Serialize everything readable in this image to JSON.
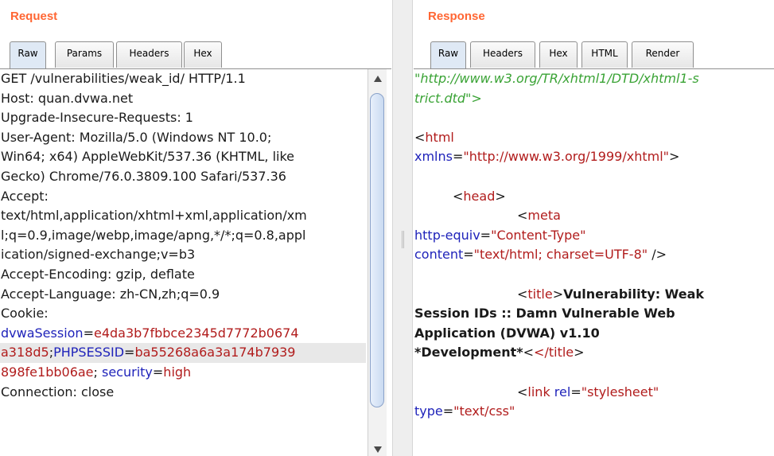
{
  "request": {
    "title": "Request",
    "tabs": [
      "Raw",
      "Params",
      "Headers",
      "Hex"
    ],
    "lines": [
      "GET /vulnerabilities/weak_id/ HTTP/1.1",
      "Host: quan.dvwa.net",
      "Upgrade-Insecure-Requests: 1",
      "User-Agent: Mozilla/5.0 (Windows NT 10.0;",
      "Win64; x64) AppleWebKit/537.36 (KHTML, like",
      "Gecko) Chrome/76.0.3809.100 Safari/537.36",
      "Accept:",
      "text/html,application/xhtml+xml,application/xm",
      "l;q=0.9,image/webp,image/apng,*/*;q=0.8,appl",
      "ication/signed-exchange;v=b3",
      "Accept-Encoding: gzip, deflate",
      "Accept-Language: zh-CN,zh;q=0.9",
      "Cookie:"
    ],
    "cookie": {
      "k1": "dvwaSession",
      "v1a": "e4da3b7fbbce2345d7772b0674",
      "v1b": "a318d5",
      "sep1": ";",
      "k2": "PHPSESSID",
      "v2a": "ba55268a6a3a174b7939",
      "v2b": "898fe1bb06ae",
      "sep2": "; ",
      "k3": "security",
      "v3": "high",
      "eq": "="
    },
    "last_line": "Connection: close"
  },
  "response": {
    "title": "Response",
    "tabs": [
      "Raw",
      "Headers",
      "Hex",
      "HTML",
      "Render"
    ],
    "dtd1": "\"http://www.w3.org/TR/xhtml1/DTD/xhtml1-s",
    "dtd2": "trict.dtd\">",
    "lt": "<",
    "gt": ">",
    "html_tag": "html",
    "xmlns_attr": "xmlns",
    "xmlns_val": "\"http://www.w3.org/1999/xhtml\"",
    "head_tag": "head",
    "meta_tag": "meta",
    "httpequiv_attr": "http-equiv",
    "httpequiv_val": "\"Content-Type\"",
    "content_attr": "content",
    "content_val": "\"text/html; charset=UTF-8\"",
    "selfclose": " />",
    "title_tag": "title",
    "title_close": "</title",
    "title_text1": "Vulnerability: Weak",
    "title_text2": "Session IDs :: Damn Vulnerable Web",
    "title_text3": "Application (DVWA) v1.10",
    "title_text4": "*Development*",
    "link_tag": "link",
    "rel_attr": "rel",
    "rel_val": "\"stylesheet\"",
    "type_attr": "type",
    "type_val": "\"text/css\"",
    "eq": "="
  }
}
